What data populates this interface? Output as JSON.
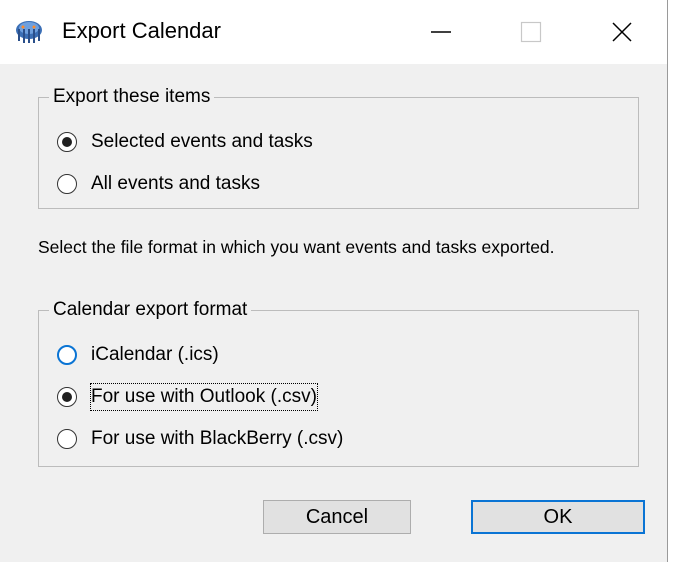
{
  "window": {
    "title": "Export Calendar",
    "app_icon": "calendar-app-icon",
    "controls": {
      "minimize_icon": "minimize-icon",
      "maximize_icon": "maximize-icon",
      "close_icon": "close-icon"
    }
  },
  "export_items": {
    "legend": "Export these items",
    "options": [
      {
        "label": "Selected events and tasks",
        "selected": true
      },
      {
        "label": "All events and tasks",
        "selected": false
      }
    ]
  },
  "description": "Select the file format in which you want events and tasks exported.",
  "export_format": {
    "legend": "Calendar export format",
    "options": [
      {
        "label": "iCalendar (.ics)",
        "selected": false
      },
      {
        "label": "For use with Outlook (.csv)",
        "selected": true
      },
      {
        "label": "For use with BlackBerry (.csv)",
        "selected": false
      }
    ]
  },
  "buttons": {
    "cancel": "Cancel",
    "ok": "OK"
  },
  "colors": {
    "accent": "#0a74d4",
    "dialog_background": "#f0f0f0"
  }
}
